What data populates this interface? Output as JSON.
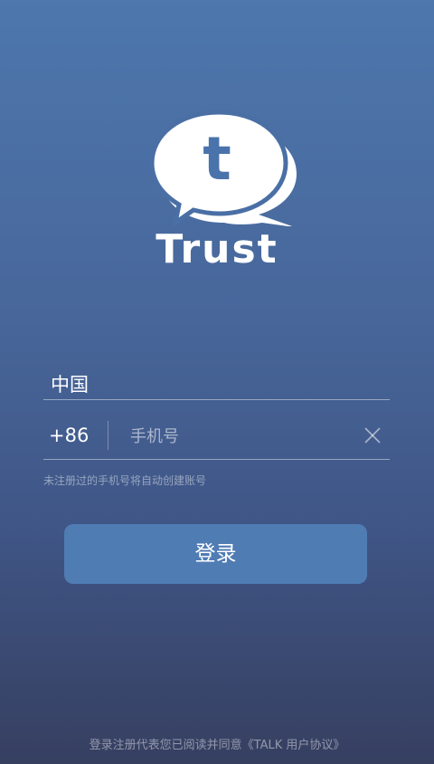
{
  "brand": {
    "logo_letter": "t",
    "name": "Trust"
  },
  "form": {
    "country": "中国",
    "country_code": "+86",
    "phone_placeholder": "手机号",
    "phone_value": "",
    "hint": "未注册过的手机号将自动创建账号"
  },
  "login_button": {
    "label": "登录"
  },
  "footer": {
    "agreement_prefix": "登录注册代表您已阅读并同意",
    "agreement_link": "《TALK 用户协议》"
  },
  "colors": {
    "accent": "#507cb4",
    "logo_letter": "#4a73ac",
    "background_top": "#4d77ad",
    "background_bottom": "#363f60"
  },
  "icons": {
    "logo": "chat-bubbles-icon",
    "clear": "close-icon"
  }
}
